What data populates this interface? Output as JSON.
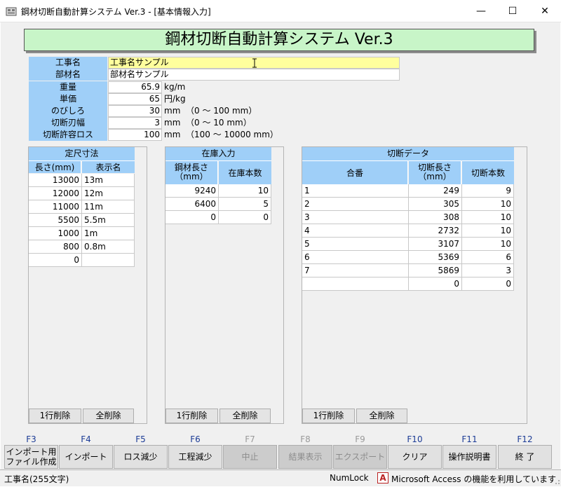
{
  "window": {
    "title": "鋼材切断自動計算システム Ver.3 - [基本情報入力]",
    "minimize_glyph": "—",
    "maximize_glyph": "☐",
    "close_glyph": "✕"
  },
  "banner": {
    "title": "鋼材切断自動計算システム Ver.3"
  },
  "form": {
    "fields": [
      {
        "label": "工事名",
        "value": "工事名サンプル",
        "unit": ""
      },
      {
        "label": "部材名",
        "value": "部材名サンプル",
        "unit": ""
      },
      {
        "label": "重量",
        "value": "65.9",
        "unit": "kg/m"
      },
      {
        "label": "単価",
        "value": "65",
        "unit": "円/kg"
      },
      {
        "label": "のびしろ",
        "value": "30",
        "unit": "mm  （0 ～ 100 mm）"
      },
      {
        "label": "切断刃幅",
        "value": "3",
        "unit": "mm  （0 ～ 10 mm）"
      },
      {
        "label": "切断許容ロス",
        "value": "100",
        "unit": "mm  （100 ～ 10000 mm）"
      }
    ]
  },
  "standard_lengths": {
    "title": "定尺寸法",
    "columns": [
      "長さ(mm)",
      "表示名"
    ],
    "rows": [
      [
        "13000",
        "13m"
      ],
      [
        "12000",
        "12m"
      ],
      [
        "11000",
        "11m"
      ],
      [
        "5500",
        "5.5m"
      ],
      [
        "1000",
        "1m"
      ],
      [
        "800",
        "0.8m"
      ],
      [
        "0",
        ""
      ]
    ],
    "delete_row": "1行削除",
    "delete_all": "全削除"
  },
  "stock": {
    "title": "在庫入力",
    "columns": [
      "鋼材長さ\n（mm）",
      "在庫本数"
    ],
    "rows": [
      [
        "9240",
        "10"
      ],
      [
        "6400",
        "5"
      ],
      [
        "0",
        "0"
      ]
    ],
    "delete_row": "1行削除",
    "delete_all": "全削除"
  },
  "cut_data": {
    "title": "切断データ",
    "columns": [
      "合番",
      "切断長さ\n（mm）",
      "切断本数"
    ],
    "rows": [
      [
        "1",
        "249",
        "9"
      ],
      [
        "2",
        "305",
        "10"
      ],
      [
        "3",
        "308",
        "10"
      ],
      [
        "4",
        "2732",
        "10"
      ],
      [
        "5",
        "3107",
        "10"
      ],
      [
        "6",
        "5369",
        "6"
      ],
      [
        "7",
        "5869",
        "3"
      ],
      [
        "",
        "0",
        "0"
      ]
    ],
    "delete_row": "1行削除",
    "delete_all": "全削除"
  },
  "function_keys": [
    {
      "key": "F3",
      "label": "インポート用\nファイル作成",
      "enabled": true
    },
    {
      "key": "F4",
      "label": "インポート",
      "enabled": true
    },
    {
      "key": "F5",
      "label": "ロス減少",
      "enabled": true
    },
    {
      "key": "F6",
      "label": "工程減少",
      "enabled": true
    },
    {
      "key": "F7",
      "label": "中止",
      "enabled": false
    },
    {
      "key": "F8",
      "label": "結果表示",
      "enabled": false
    },
    {
      "key": "F9",
      "label": "エクスポート",
      "enabled": false
    },
    {
      "key": "F10",
      "label": "クリア",
      "enabled": true
    },
    {
      "key": "F11",
      "label": "操作説明書",
      "enabled": true
    },
    {
      "key": "F12",
      "label": "終 了",
      "enabled": true
    }
  ],
  "status": {
    "left": "工事名(255文字)",
    "numlock": "NumLock",
    "access_icon": "A",
    "access_text": "Microsoft Access の機能を利用しています"
  },
  "colors": {
    "header_blue": "#9fcff8",
    "banner_green": "#c8f5c8",
    "highlight_yellow": "#ffff9d"
  }
}
